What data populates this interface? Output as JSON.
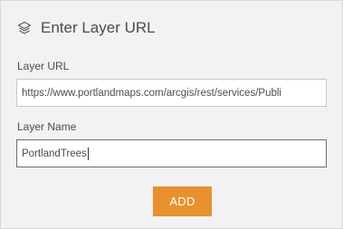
{
  "header": {
    "title": "Enter Layer URL",
    "icon": "layers-icon"
  },
  "url_field": {
    "label": "Layer URL",
    "value": "https://www.portlandmaps.com/arcgis/rest/services/Publi"
  },
  "name_field": {
    "label": "Layer Name",
    "value": "PortlandTrees"
  },
  "actions": {
    "add_label": "ADD"
  },
  "colors": {
    "panel_bg": "#f2f2f2",
    "accent": "#e8912e",
    "text": "#4c4c4c"
  }
}
